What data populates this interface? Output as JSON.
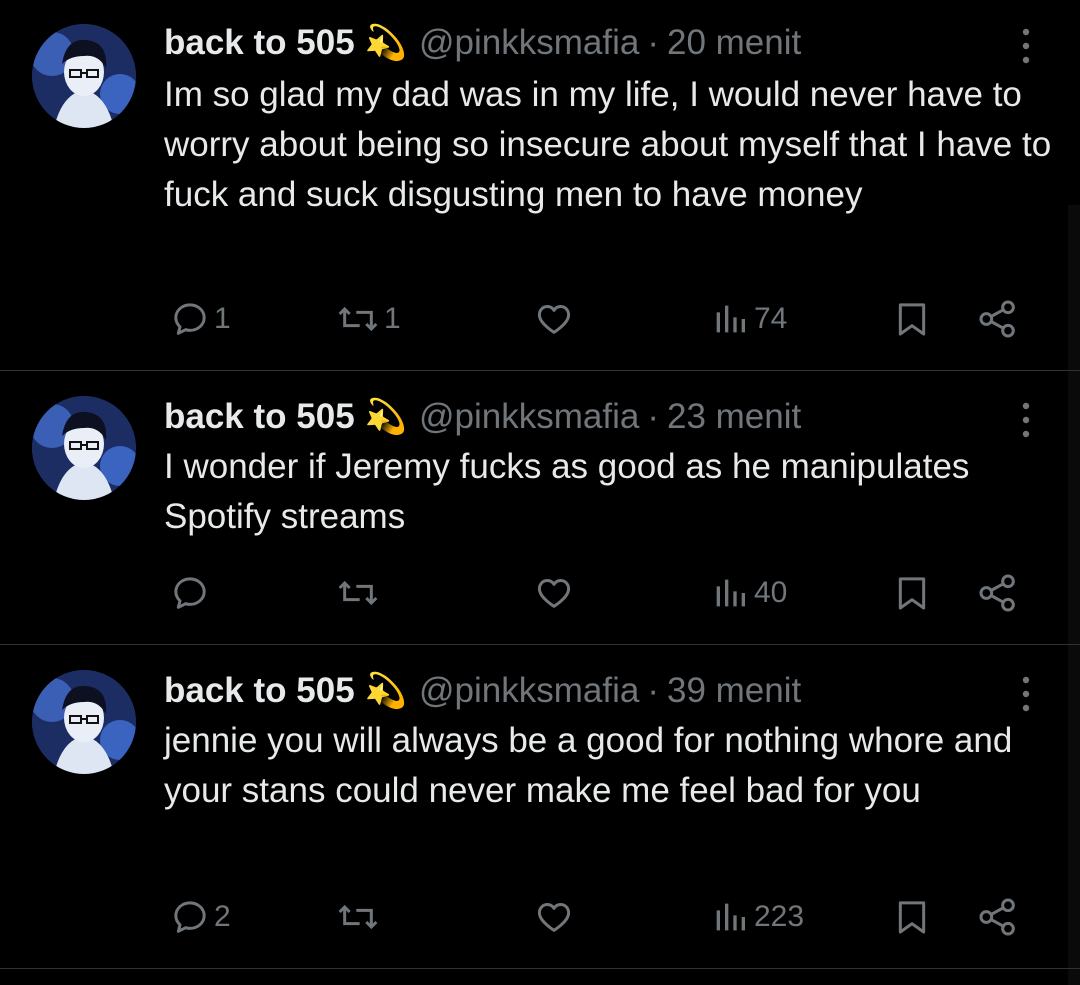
{
  "tweets": [
    {
      "author_name": "back to 505",
      "badge": "💫",
      "handle": "@pinkksmafia",
      "separator": "·",
      "time": "20 menit",
      "text": "Im so glad my dad was in my life, I would never have to worry about being so insecure about myself that I have to fuck and suck disgusting men to have money",
      "replies": "1",
      "retweets": "1",
      "likes": "",
      "views": "74"
    },
    {
      "author_name": "back to 505",
      "badge": "💫",
      "handle": "@pinkksmafia",
      "separator": "·",
      "time": "23 menit",
      "text": "I wonder if Jeremy fucks as good as he manipulates Spotify streams",
      "replies": "",
      "retweets": "",
      "likes": "",
      "views": "40"
    },
    {
      "author_name": "back to 505",
      "badge": "💫",
      "handle": "@pinkksmafia",
      "separator": "·",
      "time": "39 menit",
      "text": "jennie you will always be a good for nothing whore and your stans could never make me feel bad for you",
      "replies": "2",
      "retweets": "",
      "likes": "",
      "views": "223"
    }
  ],
  "icons": {
    "reply": "reply-icon",
    "retweet": "retweet-icon",
    "like": "heart-icon",
    "views": "views-chart-icon",
    "bookmark": "bookmark-icon",
    "share": "share-icon",
    "more": "more-vertical-icon"
  },
  "colors": {
    "background": "#000000",
    "text": "#e7e9ea",
    "muted": "#71767b",
    "divider": "#2f3336"
  }
}
